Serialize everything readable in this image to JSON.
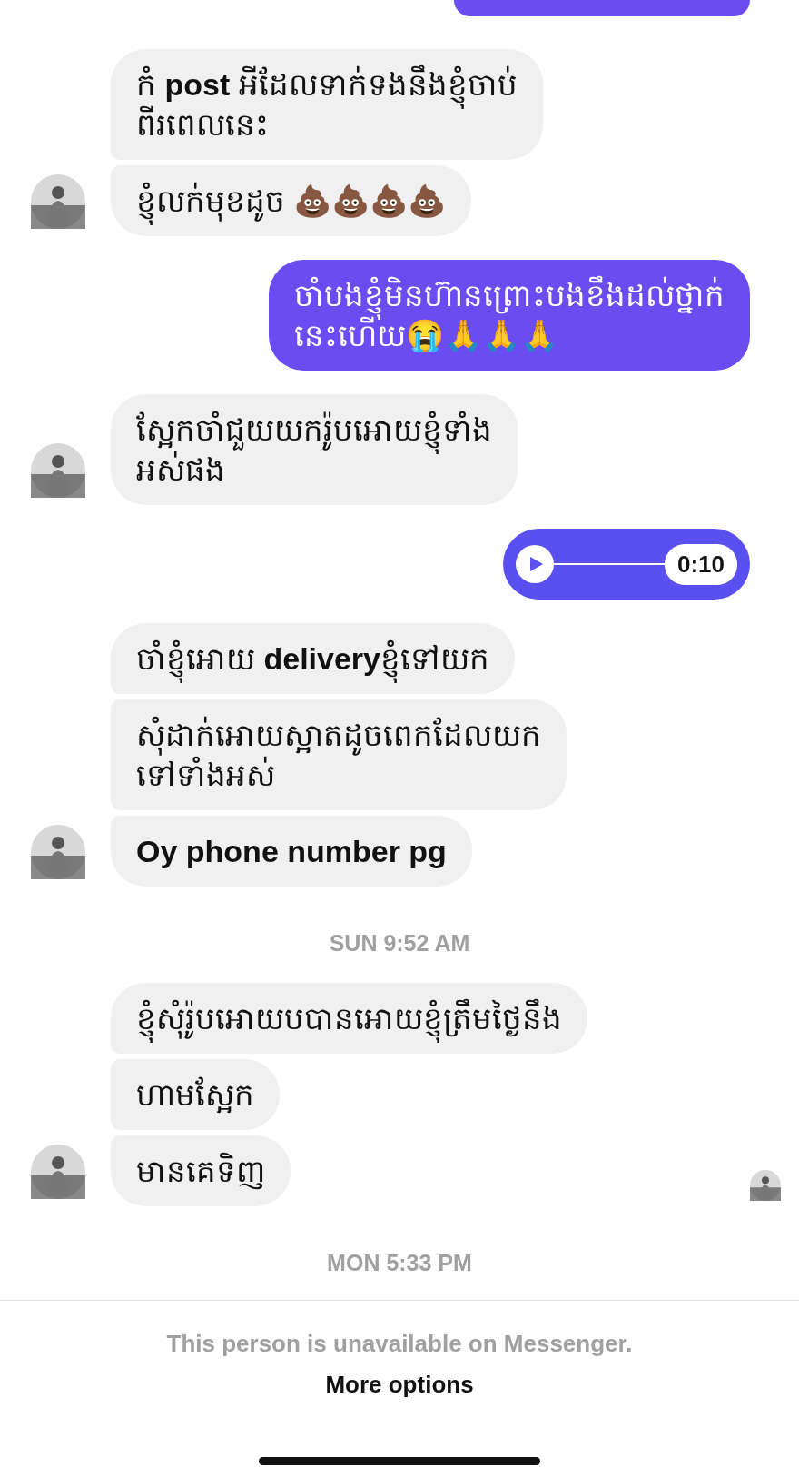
{
  "messages": [
    {
      "kind": "received",
      "lines": [
        "កំ **post** អីដែលទាក់ទងនឹងខ្ញុំចាប់",
        "ពីរពេលនេះ"
      ],
      "avatar": false,
      "seen": false
    },
    {
      "kind": "received",
      "lines": [
        "ខ្ញុំលក់មុខដូច 💩💩💩💩"
      ],
      "avatar": true,
      "seen": false
    },
    {
      "kind": "sent",
      "lines": [
        "ចាំបងខ្ញុំមិនហ៊ានព្រោះបងខឹងដល់ថ្នាក់",
        "នេះហើយ😭🙏🙏🙏"
      ],
      "seen": false
    },
    {
      "kind": "received",
      "lines": [
        "ស្អែកចាំជួយយករ៉ូបអោយខ្ញុំទាំង",
        "អស់ផង"
      ],
      "avatar": true,
      "seen": false
    },
    {
      "kind": "audio",
      "duration": "0:10"
    },
    {
      "kind": "received",
      "lines": [
        "ចាំខ្ញុំអោយ **delivery**ខ្ញុំទៅយក"
      ],
      "avatar": false,
      "seen": false
    },
    {
      "kind": "received",
      "lines": [
        "សុំដាក់អោយស្អាតដូចពេកដែលយក",
        "ទៅទាំងអស់"
      ],
      "avatar": false,
      "seen": false
    },
    {
      "kind": "received",
      "lines": [
        "**Oy phone number pg**"
      ],
      "avatar": true,
      "seen": false
    },
    {
      "kind": "time",
      "text": "SUN 9:52 AM"
    },
    {
      "kind": "received",
      "lines": [
        "ខ្ញុំសុំរ៉ូបអោយបបានអោយខ្ញុំត្រឹមថ្ងៃនឹង"
      ],
      "avatar": false,
      "seen": false
    },
    {
      "kind": "received",
      "lines": [
        "ហាមស្អែក"
      ],
      "avatar": false,
      "seen": false
    },
    {
      "kind": "received",
      "lines": [
        "មានគេទិញ"
      ],
      "avatar": true,
      "seen": true
    },
    {
      "kind": "time",
      "text": "MON 5:33 PM"
    }
  ],
  "footer": {
    "notice": "This person is unavailable on Messenger.",
    "link": "More options"
  }
}
